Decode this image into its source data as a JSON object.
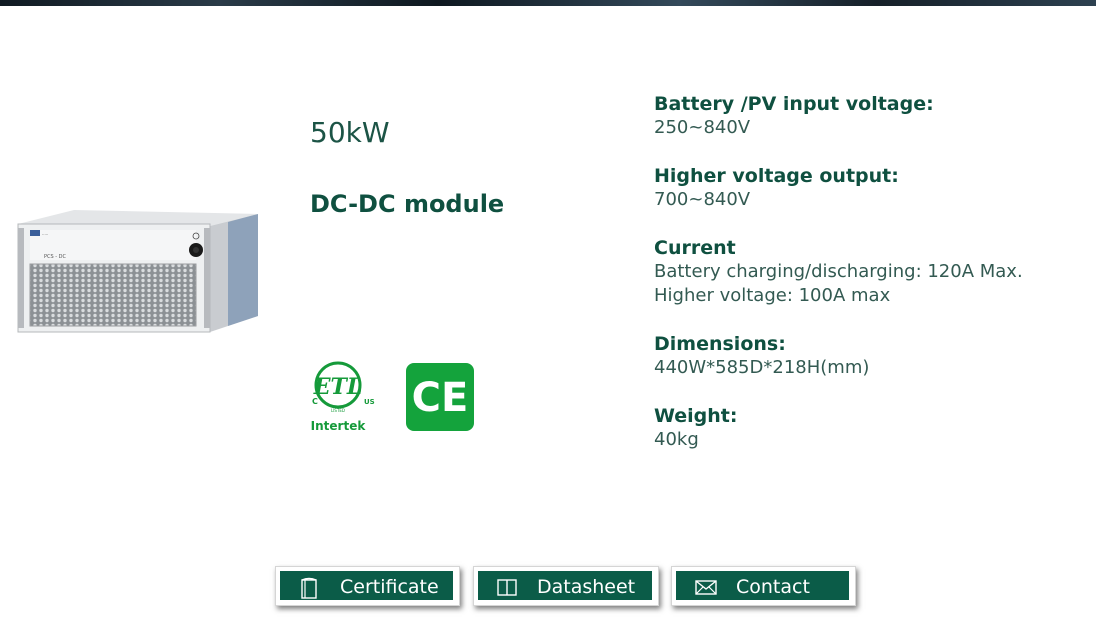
{
  "product": {
    "power": "50kW",
    "type": "DC-DC module",
    "front_panel_text": "PCS - DC"
  },
  "certifications": {
    "etl": {
      "mark_text": "ETL",
      "left": "C",
      "right": "US",
      "small": "LISTED",
      "brand": "Intertek"
    },
    "ce": {
      "mark_text": "CE",
      "color": "#14a33c"
    }
  },
  "specs": [
    {
      "title": "Battery /PV input voltage:",
      "lines": [
        "250~840V"
      ]
    },
    {
      "title": "Higher voltage output:",
      "lines": [
        "700~840V"
      ]
    },
    {
      "title": "Current",
      "lines": [
        "Battery charging/discharging: 120A Max.",
        "Higher voltage: 100A max"
      ]
    },
    {
      "title": "Dimensions:",
      "lines": [
        "440W*585D*218H(mm)"
      ]
    },
    {
      "title": "Weight:",
      "lines": [
        "40kg"
      ]
    }
  ],
  "buttons": {
    "certificate": {
      "label": "Certificate",
      "icon": "document-icon"
    },
    "datasheet": {
      "label": "Datasheet",
      "icon": "book-icon"
    },
    "contact": {
      "label": "Contact",
      "icon": "envelope-icon"
    }
  },
  "colors": {
    "accent": "#0b5c48",
    "heading": "#0f5040",
    "text": "#335a52"
  }
}
